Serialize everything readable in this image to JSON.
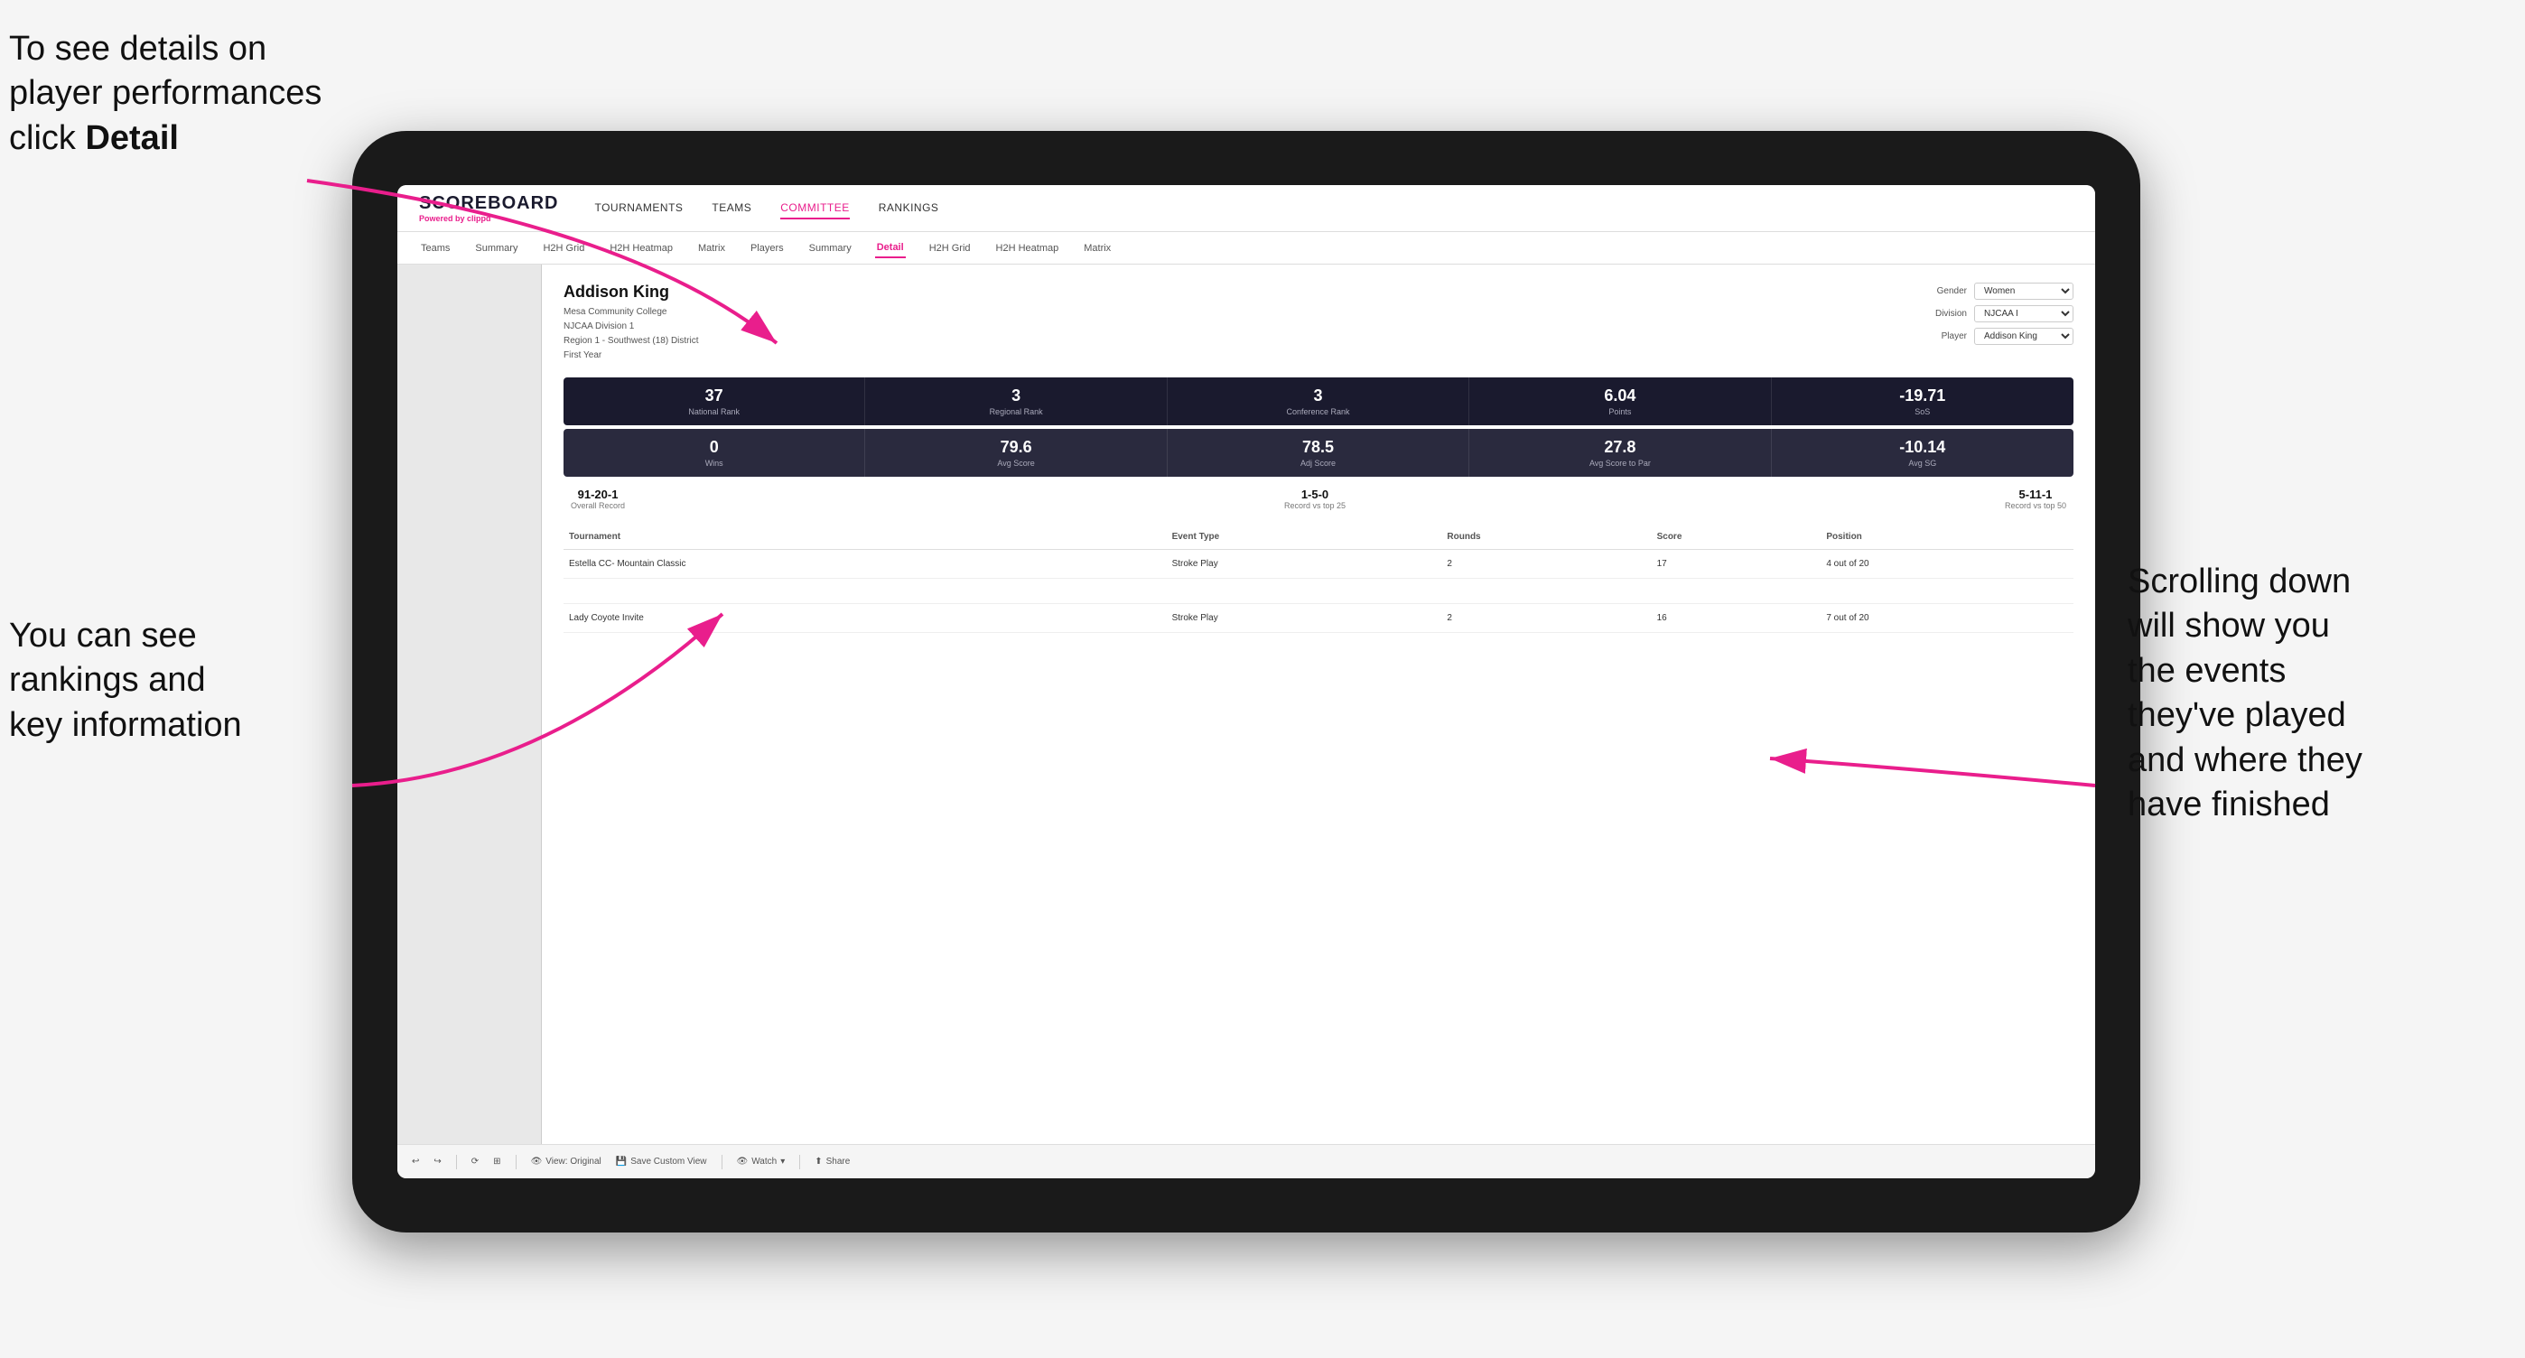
{
  "annotations": {
    "topleft": "To see details on player performances click ",
    "topleft_bold": "Detail",
    "bottomleft_line1": "You can see",
    "bottomleft_line2": "rankings and",
    "bottomleft_line3": "key information",
    "right_line1": "Scrolling down",
    "right_line2": "will show you",
    "right_line3": "the events",
    "right_line4": "they've played",
    "right_line5": "and where they",
    "right_line6": "have finished"
  },
  "topnav": {
    "logo": "SCOREBOARD",
    "powered_by": "Powered by",
    "brand": "clippd",
    "items": [
      "TOURNAMENTS",
      "TEAMS",
      "COMMITTEE",
      "RANKINGS"
    ]
  },
  "subnav": {
    "items": [
      "Teams",
      "Summary",
      "H2H Grid",
      "H2H Heatmap",
      "Matrix",
      "Players",
      "Summary",
      "Detail",
      "H2H Grid",
      "H2H Heatmap",
      "Matrix"
    ]
  },
  "player": {
    "name": "Addison King",
    "college": "Mesa Community College",
    "division": "NJCAA Division 1",
    "region": "Region 1 - Southwest (18) District",
    "year": "First Year"
  },
  "controls": {
    "gender_label": "Gender",
    "gender_value": "Women",
    "division_label": "Division",
    "division_value": "NJCAA I",
    "player_label": "Player",
    "player_value": "Addison King"
  },
  "stats_row1": [
    {
      "value": "37",
      "label": "National Rank"
    },
    {
      "value": "3",
      "label": "Regional Rank"
    },
    {
      "value": "3",
      "label": "Conference Rank"
    },
    {
      "value": "6.04",
      "label": "Points"
    },
    {
      "value": "-19.71",
      "label": "SoS"
    }
  ],
  "stats_row2": [
    {
      "value": "0",
      "label": "Wins"
    },
    {
      "value": "79.6",
      "label": "Avg Score"
    },
    {
      "value": "78.5",
      "label": "Adj Score"
    },
    {
      "value": "27.8",
      "label": "Avg Score to Par"
    },
    {
      "value": "-10.14",
      "label": "Avg SG"
    }
  ],
  "records": [
    {
      "value": "91-20-1",
      "label": "Overall Record"
    },
    {
      "value": "1-5-0",
      "label": "Record vs top 25"
    },
    {
      "value": "5-11-1",
      "label": "Record vs top 50"
    }
  ],
  "table": {
    "headers": [
      "Tournament",
      "Event Type",
      "Rounds",
      "Score",
      "Position"
    ],
    "rows": [
      {
        "tournament": "Estella CC- Mountain Classic",
        "event_type": "Stroke Play",
        "rounds": "2",
        "score": "17",
        "position": "4 out of 20"
      },
      {
        "tournament": "",
        "event_type": "",
        "rounds": "",
        "score": "",
        "position": ""
      },
      {
        "tournament": "Lady Coyote Invite",
        "event_type": "Stroke Play",
        "rounds": "2",
        "score": "16",
        "position": "7 out of 20"
      }
    ]
  },
  "toolbar": {
    "undo": "↩",
    "redo": "↪",
    "view_original": "View: Original",
    "save_custom": "Save Custom View",
    "watch": "Watch",
    "share": "Share"
  }
}
